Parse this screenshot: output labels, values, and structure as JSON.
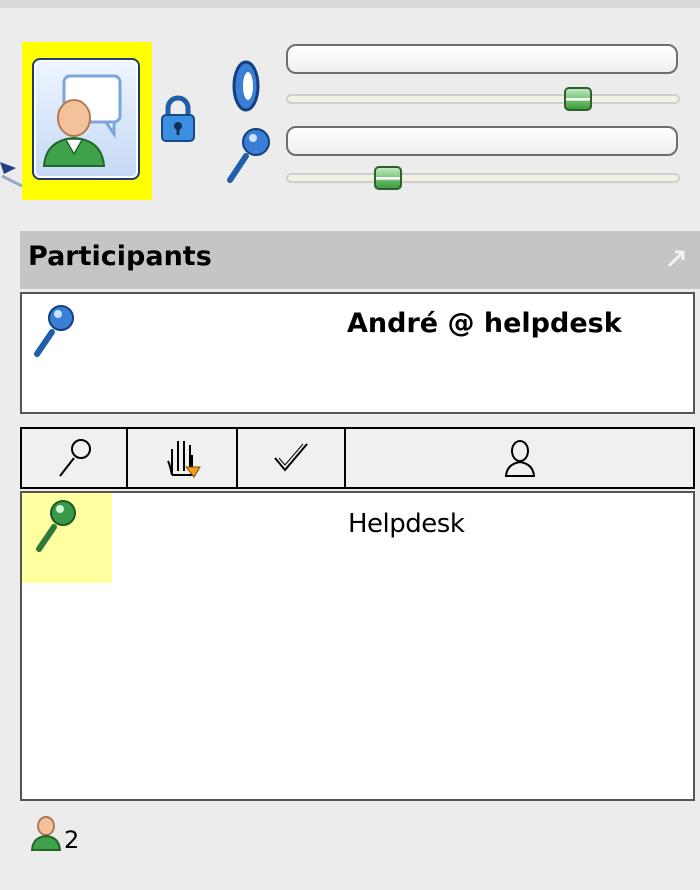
{
  "icons": {
    "talk_button": "person-speech-icon",
    "lock": "lock-icon",
    "speaker": "speaker-icon",
    "microphone": "microphone-icon",
    "expand": "expand-icon",
    "raise_hand": "raise-hand-icon",
    "check": "check-icon",
    "user": "user-icon"
  },
  "colors": {
    "highlight_yellow": "#ffff00",
    "row_highlight": "#ffffa0",
    "mic_blue": "#3a7fd5",
    "mic_green": "#3a9a4a",
    "slider_green": "#5fb55f",
    "header_gray": "#c5c5c5"
  },
  "audio": {
    "speaker_volume": 0.74,
    "mic_volume": 0.26,
    "speaker_level": 0,
    "mic_level": 0
  },
  "participants_panel": {
    "title": "Participants",
    "self_name": "André @ helpdesk",
    "columns": [
      "microphone",
      "raise-hand",
      "check",
      "user"
    ],
    "rows": [
      {
        "name": "Helpdesk",
        "talking": true
      }
    ],
    "participant_count": "2"
  }
}
